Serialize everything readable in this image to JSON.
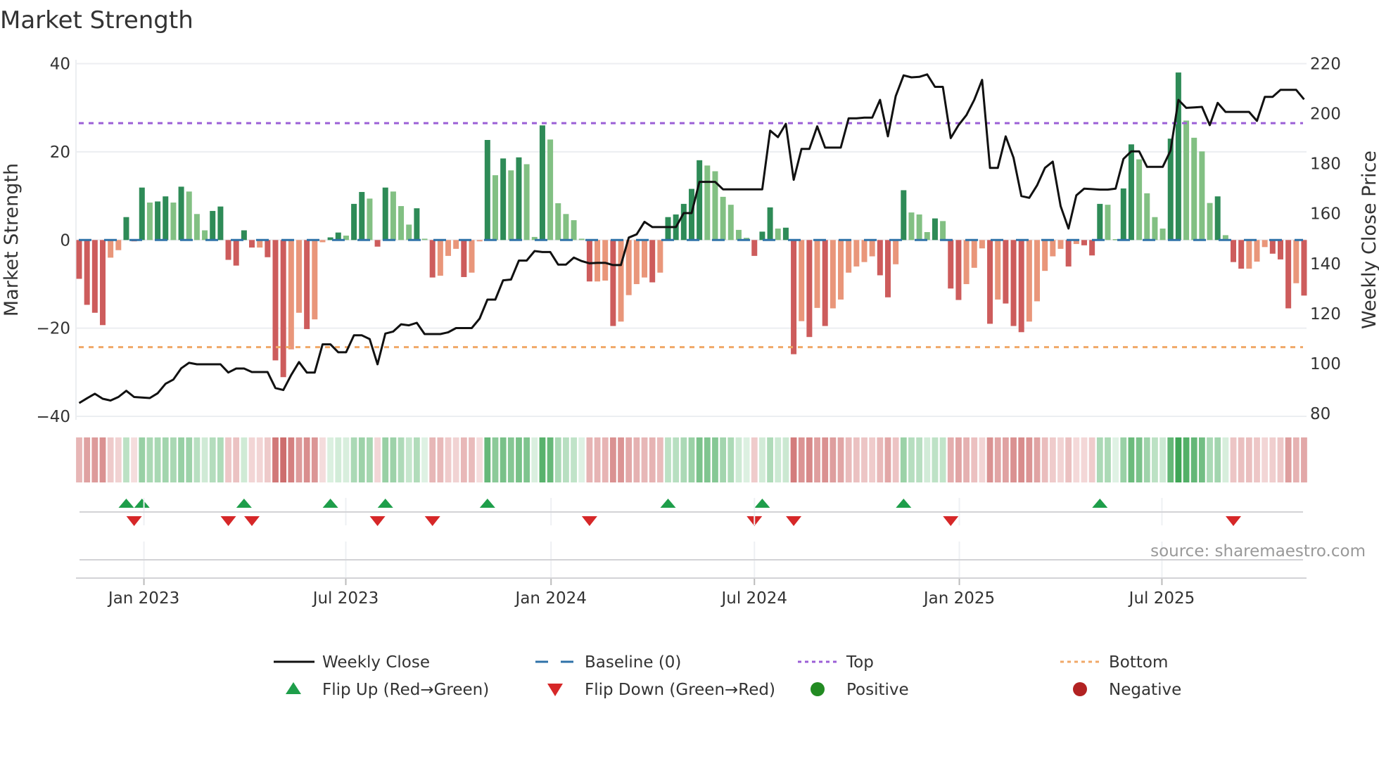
{
  "chart_data": {
    "type": "bar",
    "title": "Market Strength",
    "ylabel": "Market Strength",
    "y2label": "Weekly Close Price",
    "ylim": [
      -40,
      40
    ],
    "y2lim": [
      80,
      220
    ],
    "yticks": [
      40,
      20,
      0,
      -20,
      -40
    ],
    "ytick_labels": [
      "40",
      "20",
      "0",
      "−20",
      "−40"
    ],
    "y2ticks": [
      220,
      200,
      180,
      160,
      140,
      120,
      100,
      80
    ],
    "y2tick_labels": [
      "220",
      "200",
      "180",
      "160",
      "140",
      "120",
      "100",
      "80"
    ],
    "xticks": [
      {
        "label": "Jan 2023",
        "week": 8.25
      },
      {
        "label": "Jul 2023",
        "week": 33.96
      },
      {
        "label": "Jan 2024",
        "week": 60.1
      },
      {
        "label": "Jul 2024",
        "week": 86.0
      },
      {
        "label": "Jan 2025",
        "week": 112.1
      },
      {
        "label": "Jul 2025",
        "week": 137.9
      }
    ],
    "top_level": 26.5,
    "bottom_level": -24.3,
    "baseline": 0,
    "grid": true,
    "legend_position": "bottom",
    "series": [
      {
        "name": "Market Strength",
        "type": "bar",
        "values": [
          -8.8,
          -14.7,
          -16.5,
          -19.3,
          -4,
          -2.3,
          5.2,
          -0.3,
          11.9,
          8.5,
          8.75,
          9.9,
          8.5,
          12.1,
          11,
          5.9,
          2.2,
          6.6,
          7.6,
          -4.5,
          -5.8,
          2.2,
          -1.7,
          -1.7,
          -3.9,
          -27.3,
          -31.1,
          -24.8,
          -16.5,
          -20.2,
          -18,
          -0.5,
          0.6,
          1.7,
          1,
          8.2,
          10.9,
          9.4,
          -1.5,
          11.9,
          11,
          7.7,
          3.5,
          7.2,
          0.3,
          -8.5,
          -8.1,
          -3.6,
          -2,
          -8.4,
          -7.4,
          -0.3,
          22.7,
          14.7,
          18.5,
          15.8,
          18.75,
          17.2,
          0.7,
          26,
          22.8,
          8.35,
          5.9,
          4.5,
          0.3,
          -9.4,
          -9.4,
          -9.2,
          -19.5,
          -18.5,
          -12.5,
          -10,
          -8.5,
          -9.6,
          -7.4,
          5.2,
          5.8,
          8.2,
          11.6,
          18.1,
          16.9,
          15.6,
          9.8,
          8,
          2.3,
          0.5,
          -3.6,
          1.9,
          7.4,
          2.6,
          2.8,
          -25.9,
          -18.4,
          -22,
          -15.4,
          -19.5,
          -15.5,
          -13.5,
          -7.4,
          -6,
          -5,
          -3.7,
          -8,
          -13,
          -5.5,
          11.3,
          6.25,
          5.8,
          1.8,
          4.9,
          4.3,
          -11,
          -13.6,
          -10,
          -6.3,
          -1.9,
          -19,
          -13.5,
          -14.4,
          -19.5,
          -20.9,
          -18.5,
          -13.9,
          -7,
          -3.7,
          -2,
          -6,
          -0.9,
          -1.2,
          -3.5,
          8.2,
          8,
          0.2,
          11.7,
          21.7,
          18.3,
          10.6,
          5.2,
          2.6,
          23,
          38,
          27.1,
          23.2,
          20.1,
          8.4,
          9.9,
          1.1,
          -5,
          -6.5,
          -6.5,
          -4.9,
          -1.6,
          -3.1,
          -4.4,
          -15.5,
          -9.8,
          -12.6
        ]
      },
      {
        "name": "Weekly Close",
        "type": "line",
        "axis": "right",
        "values": [
          84.2,
          86.1,
          87.9,
          85.9,
          85.2,
          86.6,
          89.1,
          86.6,
          86.4,
          86.2,
          88.1,
          91.9,
          93.6,
          98.1,
          100.3,
          99.7,
          99.7,
          99.7,
          99.7,
          96.4,
          98,
          98,
          96.6,
          96.6,
          96.6,
          90.2,
          89.4,
          95.4,
          100.6,
          96.4,
          96.4,
          107.7,
          107.7,
          104.5,
          104.5,
          111.3,
          111.3,
          109.8,
          99.7,
          112,
          112.8,
          115.7,
          115.3,
          116.3,
          111.8,
          111.8,
          111.8,
          112.5,
          114.2,
          114.2,
          114.2,
          118,
          125.6,
          125.6,
          133.3,
          133.6,
          141.2,
          141.2,
          145,
          144.6,
          144.6,
          139.6,
          139.6,
          142.4,
          141,
          140.1,
          140.3,
          140.3,
          139.4,
          139.4,
          150.4,
          151.7,
          156.7,
          154.6,
          154.6,
          154.6,
          154.6,
          160.2,
          160.2,
          172.7,
          172.7,
          172.7,
          169.7,
          169.7,
          169.7,
          169.7,
          169.7,
          169.7,
          193.2,
          190.6,
          195.9,
          173.5,
          185.9,
          185.9,
          194.9,
          186.4,
          186.4,
          186.4,
          198.1,
          198.1,
          198.4,
          198.4,
          205.5,
          190.9,
          207,
          215.3,
          214.5,
          214.7,
          215.7,
          210.7,
          210.7,
          190.2,
          195.4,
          199.4,
          205.5,
          213.5,
          178.3,
          178.3,
          190.9,
          182.4,
          167,
          166.3,
          171.3,
          178.3,
          180.8,
          163,
          154,
          167.3,
          170,
          169.8,
          169.6,
          169.6,
          170,
          181.9,
          184.9,
          184.9,
          178.7,
          178.7,
          178.7,
          185.2,
          205.5,
          202.3,
          202.5,
          202.7,
          195.4,
          204.3,
          200.7,
          200.7,
          200.7,
          200.7,
          197.1,
          206.7,
          206.7,
          209.5,
          209.5,
          209.5,
          205.7
        ]
      }
    ],
    "colors": {
      "pos_strong": "#2e8b57",
      "pos_weak": "#82c083",
      "neg_strong": "#cd5c5c",
      "neg_weak": "#e9967a",
      "line": "#111111",
      "baseline": "#2f72a8",
      "top": "#9b5fd6",
      "bottom": "#f0a868",
      "flip_up": "#1e9e4a",
      "flip_down": "#d62728",
      "positive": "#228b22",
      "negative": "#b22222"
    },
    "legend": [
      {
        "label": "Weekly Close",
        "icon": "solid-line"
      },
      {
        "label": "Baseline (0)",
        "icon": "dashed-line"
      },
      {
        "label": "Top",
        "icon": "dotted-line-purple"
      },
      {
        "label": "Bottom",
        "icon": "dotted-line-orange"
      },
      {
        "label": "Flip Up (Red→Green)",
        "icon": "triangle-up"
      },
      {
        "label": "Flip Down (Green→Red)",
        "icon": "triangle-down"
      },
      {
        "label": "Positive",
        "icon": "circle-green"
      },
      {
        "label": "Negative",
        "icon": "circle-red"
      }
    ],
    "source": "source: sharemaestro.com"
  }
}
